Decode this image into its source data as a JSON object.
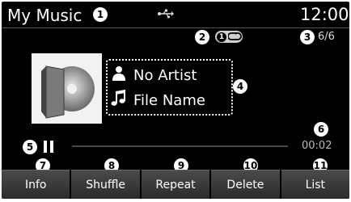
{
  "header": {
    "title": "My Music",
    "usb_icon": "usb-icon",
    "clock": "12:00"
  },
  "callouts": [
    "1",
    "2",
    "3",
    "4",
    "5",
    "6",
    "7",
    "8",
    "9",
    "10",
    "11"
  ],
  "status": {
    "repeat_badge_number": "1",
    "repeat_icon": "repeat-icon",
    "track_count": "6/6"
  },
  "track": {
    "artist": "No Artist",
    "file_name": "File Name",
    "album_art_icon": "cd-album-icon",
    "artist_icon": "person-icon",
    "file_icon": "music-note-icon"
  },
  "playback": {
    "state": "paused",
    "time": "00:02",
    "progress_fraction": 0.0
  },
  "buttons": {
    "info": "Info",
    "shuffle": "Shuffle",
    "repeat": "Repeat",
    "delete": "Delete",
    "list": "List"
  },
  "colors": {
    "screen_bg": "#000000",
    "button_gradient_top": "#4a4a4a",
    "button_gradient_bottom": "#2b2b2b"
  }
}
